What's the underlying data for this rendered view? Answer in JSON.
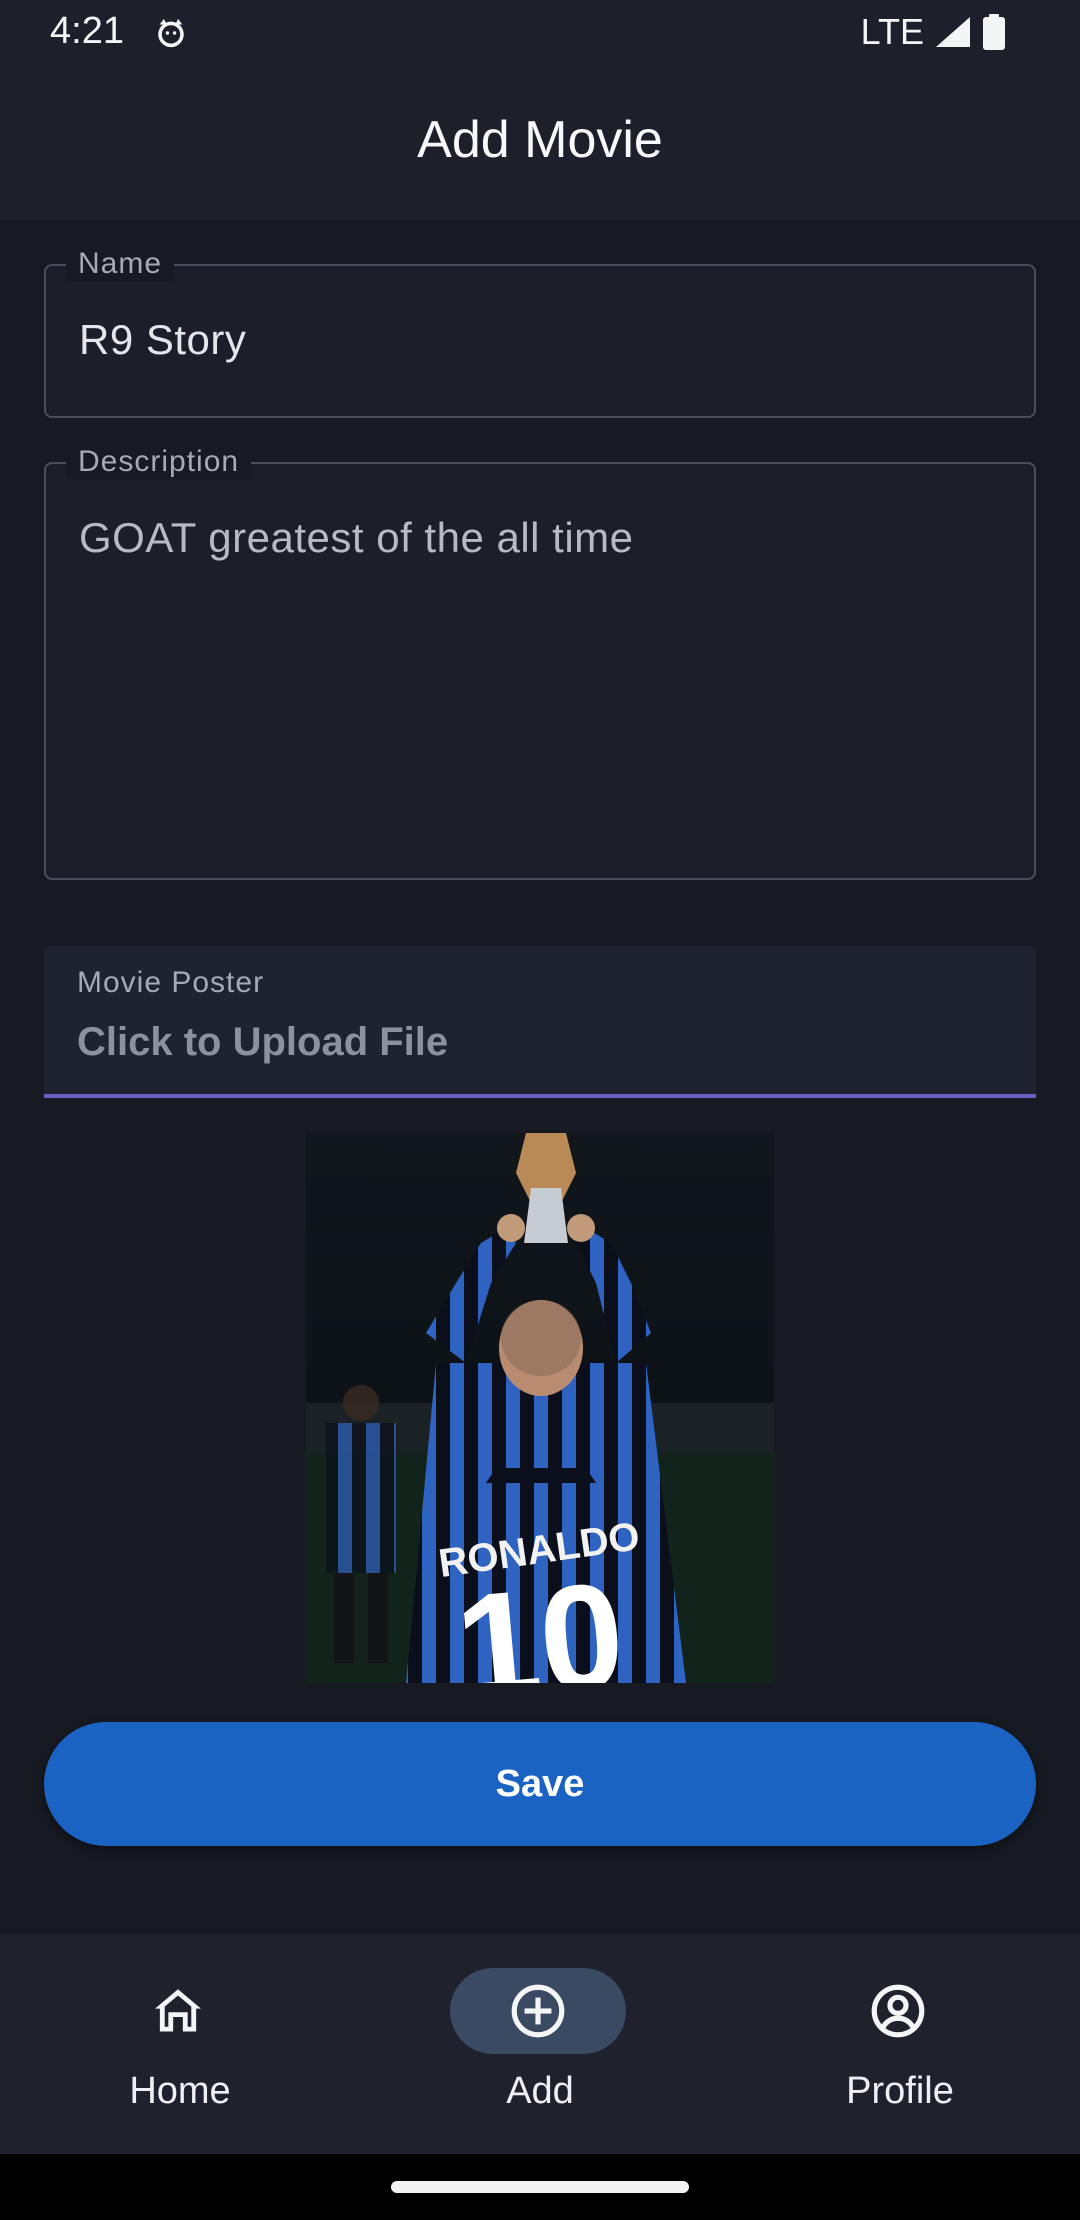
{
  "status_bar": {
    "time": "4:21",
    "network": "LTE",
    "icons": [
      "cat-notification-icon",
      "signal-icon",
      "battery-icon"
    ]
  },
  "app_bar": {
    "title": "Add Movie"
  },
  "form": {
    "name": {
      "label": "Name",
      "value": "R9 Story"
    },
    "description": {
      "label": "Description",
      "value": "GOAT greatest of the all time"
    },
    "poster": {
      "label": "Movie Poster",
      "placeholder": "Click to Upload File",
      "image_alt": "Ronaldo 10 jersey holding trophy",
      "image_text": "RONALDO"
    },
    "save_label": "Save"
  },
  "bottom_nav": {
    "items": [
      {
        "label": "Home",
        "icon": "home-icon",
        "active": false
      },
      {
        "label": "Add",
        "icon": "add-circle-icon",
        "active": true
      },
      {
        "label": "Profile",
        "icon": "profile-icon",
        "active": false
      }
    ]
  },
  "colors": {
    "background": "#171a23",
    "surface": "#1d202b",
    "accent_underline": "#6f5cc2",
    "button": "#1a63c2",
    "nav_active": "#3a4a63"
  }
}
